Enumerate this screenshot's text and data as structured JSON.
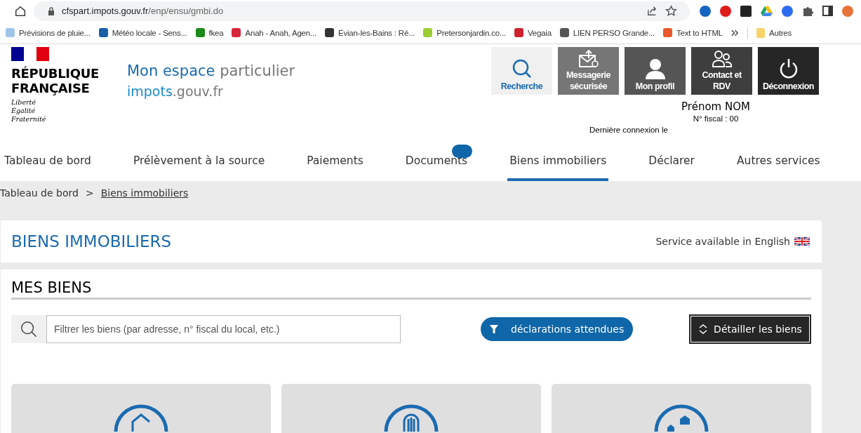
{
  "browser": {
    "url_host": "cfspart.impots.gouv.fr",
    "url_path": "/enp/ensu/gmbi.do",
    "bookmarks": [
      {
        "label": "Prévisions de pluie...",
        "color": "#9ec5e8"
      },
      {
        "label": "Météo locale - Sens...",
        "color": "#1a5fa8"
      },
      {
        "label": "fkea",
        "color": "#1a8a1a"
      },
      {
        "label": "Anah - Anah, Agen...",
        "color": "#d8253c"
      },
      {
        "label": "Évian-les-Bains : Ré...",
        "color": "#333333"
      },
      {
        "label": "Pretersonjardin.co...",
        "color": "#9acd32"
      },
      {
        "label": "Vegaia",
        "color": "#d0202f"
      },
      {
        "label": "LIEN PERSO Grande...",
        "color": "#555555"
      },
      {
        "label": "Text to HTML",
        "color": "#e8582a"
      }
    ],
    "other_bookmarks": "Autres"
  },
  "header": {
    "brand": {
      "line1": "RÉPUBLIQUE",
      "line2": "FRANÇAISE",
      "motto": [
        "Liberté",
        "Égalité",
        "Fraternité"
      ]
    },
    "site_title_main": "Mon espace",
    "site_title_rest": "particulier",
    "site_domain_main": "impots",
    "site_domain_rest": ".gouv.fr",
    "actions": [
      {
        "kind": "search",
        "label": "Recherche"
      },
      {
        "kind": "mail",
        "label": "Messagerie sécurisée"
      },
      {
        "kind": "profile",
        "label": "Mon profil"
      },
      {
        "kind": "contact",
        "label": "Contact et RDV"
      },
      {
        "kind": "logout",
        "label": "Déconnexion"
      }
    ],
    "user_name": "Prénom NOM",
    "fiscal_number": "N° fiscal : 00",
    "last_login": "Dernière connexion le"
  },
  "tabs": [
    {
      "label": "Tableau de bord",
      "selected": false,
      "badge": false
    },
    {
      "label": "Prélèvement à la source",
      "selected": false,
      "badge": false
    },
    {
      "label": "Paiements",
      "selected": false,
      "badge": false
    },
    {
      "label": "Documents",
      "selected": false,
      "badge": true
    },
    {
      "label": "Biens immobiliers",
      "selected": true,
      "badge": false
    },
    {
      "label": "Déclarer",
      "selected": false,
      "badge": false
    },
    {
      "label": "Autres services",
      "selected": false,
      "badge": false
    }
  ],
  "breadcrumb": [
    {
      "label": "Tableau de bord",
      "current": false
    },
    {
      "label": "Biens immobiliers",
      "current": true
    }
  ],
  "breadcrumb_separator": ">",
  "page_title": "BIENS IMMOBILIERS",
  "english_link": "Service available in English",
  "section_title": "MES BIENS",
  "filter": {
    "placeholder": "Filtrer les biens (par adresse, n° fiscal du local, etc.)"
  },
  "pending_button": "déclarations attendues",
  "detail_button": "Détailler les biens",
  "property_cards": [
    {
      "kind": "house"
    },
    {
      "kind": "building"
    },
    {
      "kind": "complex"
    }
  ]
}
